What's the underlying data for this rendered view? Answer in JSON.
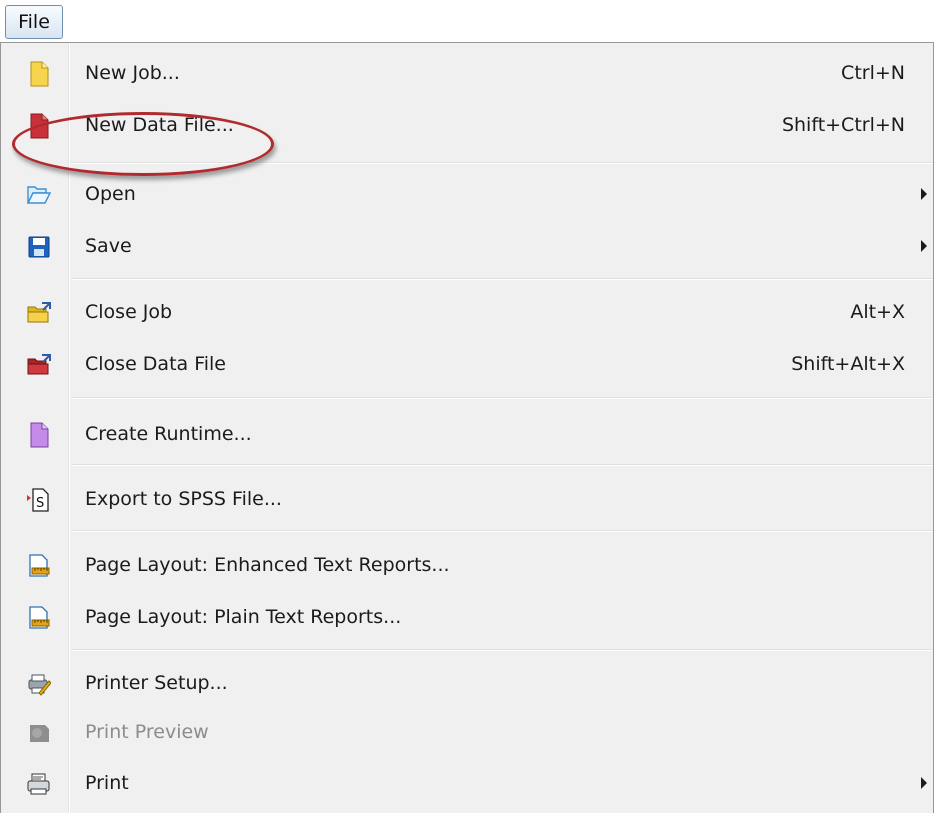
{
  "menubar": {
    "file_label": "File"
  },
  "menu": {
    "items": [
      {
        "label": "New Job...",
        "shortcut": "Ctrl+N",
        "icon": "new-job-icon"
      },
      {
        "label": "New Data File...",
        "shortcut": "Shift+Ctrl+N",
        "icon": "new-data-file-icon",
        "highlighted": true
      },
      {
        "label": "Open",
        "shortcut": "",
        "icon": "open-folder-icon",
        "submenu": true
      },
      {
        "label": "Save",
        "shortcut": "",
        "icon": "save-icon",
        "submenu": true
      },
      {
        "label": "Close Job",
        "shortcut": "Alt+X",
        "icon": "close-job-icon"
      },
      {
        "label": "Close Data File",
        "shortcut": "Shift+Alt+X",
        "icon": "close-data-file-icon"
      },
      {
        "label": "Create Runtime...",
        "shortcut": "",
        "icon": "create-runtime-icon"
      },
      {
        "label": "Export to SPSS File...",
        "shortcut": "",
        "icon": "export-spss-icon"
      },
      {
        "label": "Page Layout: Enhanced Text Reports...",
        "shortcut": "",
        "icon": "page-layout-icon"
      },
      {
        "label": "Page Layout: Plain Text Reports...",
        "shortcut": "",
        "icon": "page-layout-icon"
      },
      {
        "label": "Printer Setup...",
        "shortcut": "",
        "icon": "printer-setup-icon"
      },
      {
        "label": "Print Preview",
        "shortcut": "",
        "icon": "print-preview-icon",
        "disabled": true
      },
      {
        "label": "Print",
        "shortcut": "",
        "icon": "printer-icon",
        "submenu": true
      }
    ]
  },
  "colors": {
    "menu_background": "#f0f0f0",
    "highlight_ellipse": "#b02a2e",
    "disabled_text": "#8c8c8c"
  }
}
